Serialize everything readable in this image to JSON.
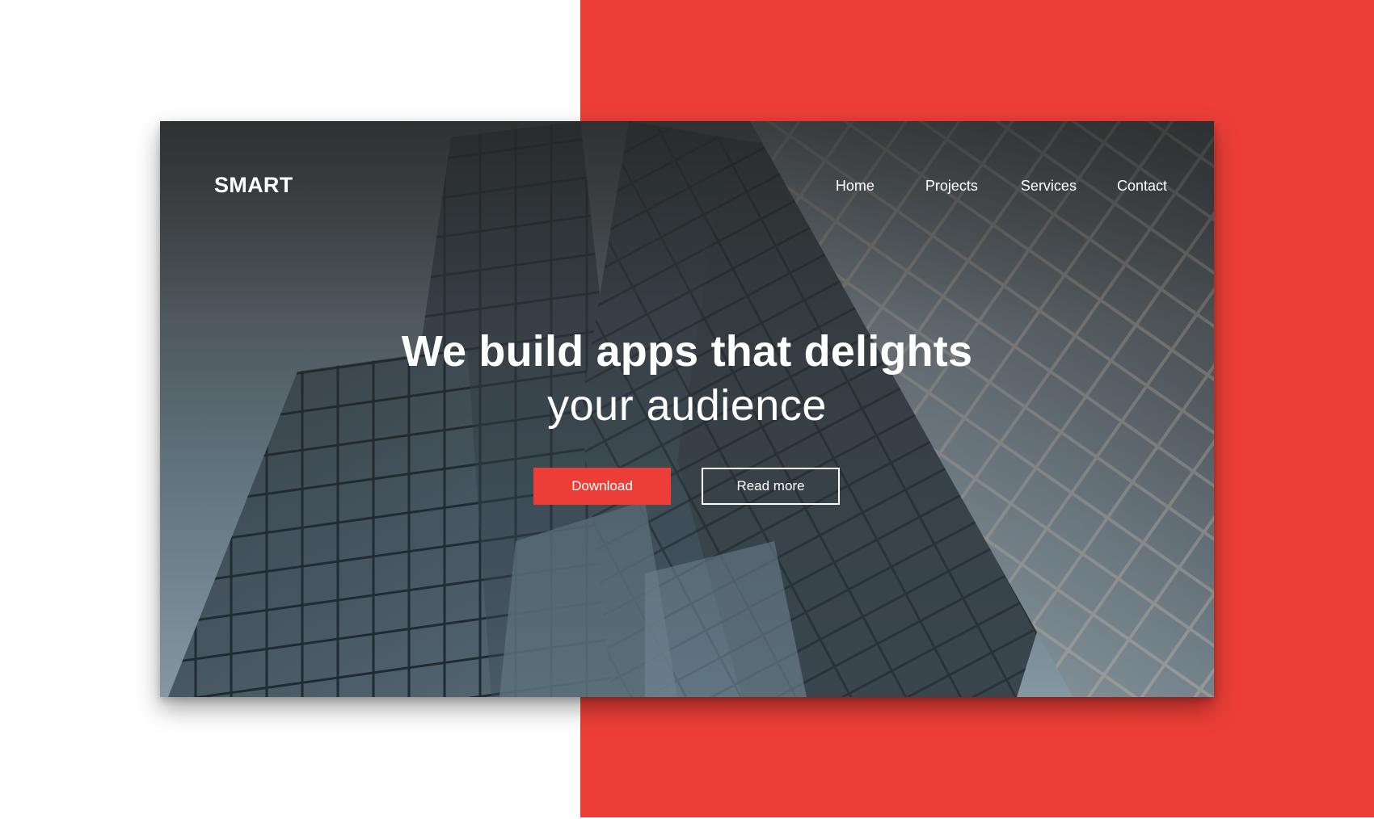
{
  "brand": {
    "logo": "SMART"
  },
  "nav": {
    "items": [
      {
        "label": "Home"
      },
      {
        "label": "Projects"
      },
      {
        "label": "Services"
      },
      {
        "label": "Contact"
      }
    ]
  },
  "hero": {
    "headline_line1": "We build apps that delights",
    "headline_line2": "your audience",
    "primary_button": "Download",
    "secondary_button": "Read more",
    "background_image": "glass-skyscraper-photo"
  },
  "colors": {
    "accent": "#ec3e37",
    "text": "#ffffff",
    "page_background": "#ffffff"
  }
}
